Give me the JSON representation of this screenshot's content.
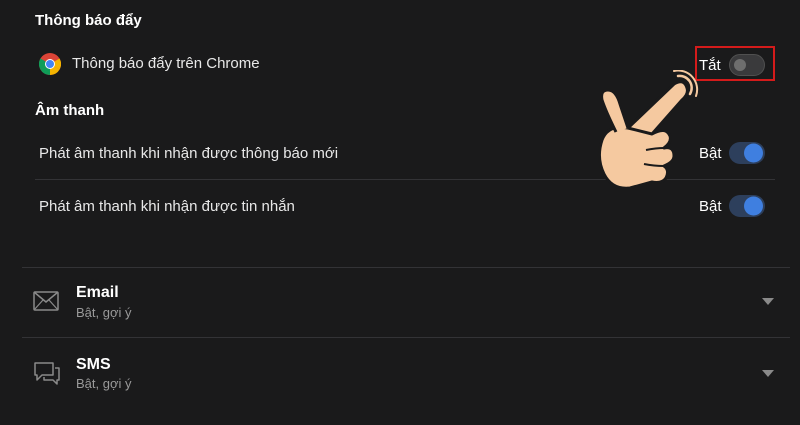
{
  "push": {
    "section_title": "Thông báo đẩy",
    "chrome_label": "Thông báo đẩy trên Chrome",
    "chrome_state": "Tắt",
    "chrome_enabled": false
  },
  "sound": {
    "section_title": "Âm thanh",
    "items": [
      {
        "label": "Phát âm thanh khi nhận được thông báo mới",
        "state": "Bật",
        "enabled": true
      },
      {
        "label": "Phát âm thanh khi nhận được tin nhắn",
        "state": "Bật",
        "enabled": true
      }
    ]
  },
  "channels": [
    {
      "title": "Email",
      "subtitle": "Bật, gợi ý",
      "icon": "envelope-icon"
    },
    {
      "title": "SMS",
      "subtitle": "Bật, gợi ý",
      "icon": "chat-bubble-icon"
    }
  ],
  "colors": {
    "background": "#1a1a1b",
    "toggle_on": "#3f7fe0",
    "highlight": "#d41b1b",
    "hand_fill": "#f5c9a0"
  }
}
